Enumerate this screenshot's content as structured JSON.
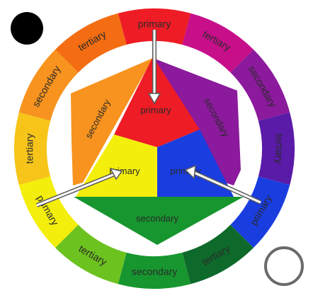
{
  "wheel": {
    "outer_ring": [
      {
        "label": "primary",
        "color": "#ee1c25"
      },
      {
        "label": "tertiary",
        "color": "#c70f8a"
      },
      {
        "label": "secondary",
        "color": "#8b1a9c"
      },
      {
        "label": "tertiary",
        "color": "#5a1ba8"
      },
      {
        "label": "primary",
        "color": "#1a3de0"
      },
      {
        "label": "tertiary",
        "color": "#0d6a2a"
      },
      {
        "label": "secondary",
        "color": "#17962f"
      },
      {
        "label": "tertiary",
        "color": "#6cc21e"
      },
      {
        "label": "primary",
        "color": "#f4ee0c"
      },
      {
        "label": "tertiary",
        "color": "#f7c51a"
      },
      {
        "label": "secondary",
        "color": "#f7931e"
      },
      {
        "label": "tertiary",
        "color": "#f46d12"
      }
    ],
    "inner": {
      "primary_top": {
        "label": "primary",
        "color": "#ee1c25"
      },
      "primary_left": {
        "label": "primary",
        "color": "#f4ee0c"
      },
      "primary_right": {
        "label": "primary",
        "color": "#1a3de0"
      },
      "secondary_left": {
        "label": "secondary",
        "color": "#f7931e"
      },
      "secondary_right": {
        "label": "secondary",
        "color": "#8b1a9c"
      },
      "secondary_bottom": {
        "label": "secondary",
        "color": "#17962f"
      }
    }
  },
  "controls": {
    "record_dot_color": "#000000",
    "shutter_button_color": "#6a6a6a"
  }
}
